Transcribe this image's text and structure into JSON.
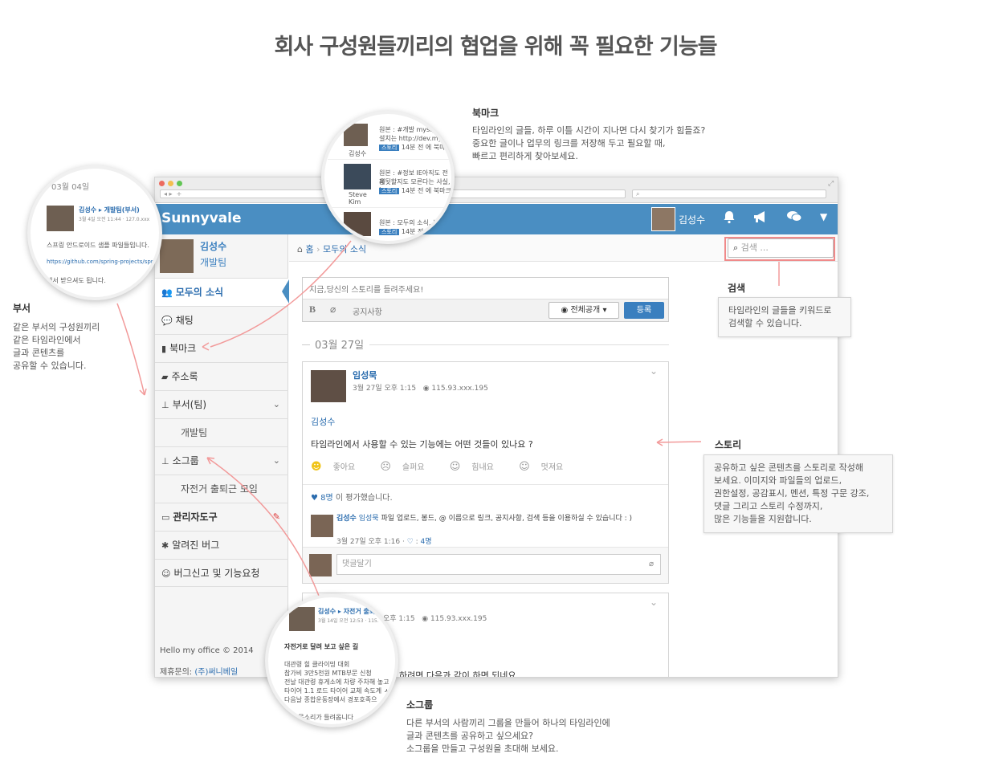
{
  "title": "회사 구성원들끼리의 협업을 위해 꼭 필요한 기능들",
  "colors": {
    "brand": "#4a8ec2",
    "link": "#2a6cae",
    "accent_line": "#f08a8a"
  },
  "app": {
    "logo": "Sunnyvale",
    "user_name": "김성수",
    "user_team": "개발팀",
    "header_icons": [
      "bell-icon",
      "megaphone-icon",
      "chat-icon",
      "caret-down-icon"
    ]
  },
  "sidebar": {
    "items": [
      {
        "label": "모두의 소식",
        "icon": "users-icon"
      },
      {
        "label": "채팅",
        "icon": "chat-icon"
      },
      {
        "label": "북마크",
        "icon": "bookmark-icon"
      },
      {
        "label": "주소록",
        "icon": "book-icon"
      },
      {
        "label": "부서(팀)",
        "icon": "sitemap-icon"
      },
      {
        "label": "개발팀",
        "icon": ""
      },
      {
        "label": "소그룹",
        "icon": "sitemap-icon"
      },
      {
        "label": "자전거 출퇴근 모임",
        "icon": ""
      },
      {
        "label": "관리자도구",
        "icon": "admin-icon"
      },
      {
        "label": "알려진 버그",
        "icon": "bug-icon"
      },
      {
        "label": "버그신고 및 기능요청",
        "icon": "smile-icon"
      }
    ],
    "footer_line1": "Hello my office © 2014",
    "footer_label": "제휴문의:",
    "footer_link": "(주)써니베일"
  },
  "breadcrumb": {
    "home": "홈",
    "current": "모두의 소식"
  },
  "search": {
    "placeholder": "검색 ..."
  },
  "composer": {
    "placeholder": "지금,당신의 스토리를 들려주세요!",
    "notice": "공지사항",
    "visibility": "전체공개",
    "submit": "등록"
  },
  "date_header": "03월 27일",
  "post": {
    "author": "임성묵",
    "meta": "3월 27일 오후 1:15",
    "ip": "115.93.xxx.195",
    "mention": "김성수",
    "body": "타임라인에서 사용할 수 있는 기능에는 어떤 것들이 있나요 ?",
    "reactions": [
      "좋아요",
      "슬퍼요",
      "힘내요",
      "멋져요"
    ],
    "rated_count": "8명",
    "rated_text": "이 평가했습니다.",
    "comment_author": "김성수",
    "comment_mention": "임성묵",
    "comment_text": "파일 업로드, 봉드, @ 이름으로 링크, 공지사항, 검색 등을 이용하실 수 있습니다 : )",
    "comment_meta": "3월 27일 오후 1:16 ·",
    "comment_likes": "4명",
    "comment_placeholder": "댓글달기"
  },
  "post2": {
    "meta": "오후 1:15",
    "ip": "115.93.xxx.195",
    "body": "하려면 다음과 같이 하면 되네요."
  },
  "callouts": {
    "bookmark": {
      "head": "북마크",
      "lines": [
        "타임라인의 글들, 하루 이틀 시간이 지나면 다시 찾기가 힘들죠?",
        "중요한 글이나 업무의 링크를 저장해 두고 필요할 때,",
        "빠르고 편리하게 찾아보세요."
      ]
    },
    "search": {
      "head": "검색",
      "lines": [
        "타임라인의 글들을 키워드로",
        "검색할 수 있습니다."
      ]
    },
    "dept": {
      "head": "부서",
      "lines": [
        "같은 부서의 구성원끼리",
        "같은 타임라인에서",
        "글과 콘텐츠를",
        "공유할 수 있습니다."
      ]
    },
    "story": {
      "head": "스토리",
      "lines": [
        "공유하고 싶은 콘텐츠를 스토리로 작성해",
        "보세요. 이미지와 파일들의 업로드,",
        "권한설정, 공감표시, 멘션, 특정 구문 강조,",
        "댓글 그리고 스토리 수정까지,",
        "많은 기능들을 지원합니다."
      ]
    },
    "group": {
      "head": "소그룹",
      "lines": [
        "다른 부서의 사람끼리 그룹을 만들어 하나의 타임라인에",
        "글과 콘텐츠를 공유하고 싶으세요?",
        "소그룹을 만들고 구성원을 초대해 보세요."
      ]
    }
  },
  "zoom_bookmark": {
    "rows": [
      {
        "name": "김성수",
        "l1": "원본 : #개발 mysql",
        "l2": "설치는 http://dev.mys",
        "tag": "스토리",
        "time": "14분 전 에 북마"
      },
      {
        "name": "Steve Kim",
        "l1": "원본 : #정보 IE아직도 전체",
        "l2": "용됫할지도 모른다는 사실, I",
        "tag": "스토리",
        "time": "14분 전 에 북마크"
      },
      {
        "name": "",
        "l1": "원본 : 모두의 소식, 브",
        "l2": "",
        "tag": "스토리",
        "time": "14분 전"
      }
    ]
  },
  "zoom_dept": {
    "date": "03월 04일",
    "author": "김성수 ▸ 개발팀(부서)",
    "meta": "3월 4일 오전 11:44 · 127.0.xxx",
    "body": "스프링 안드로이드 샘플 파일들입니다.",
    "link": "https://github.com/spring-projects/spr",
    "tail": "에서 받으셔도 됩니다."
  },
  "zoom_group": {
    "author": "김성수 ▸ 자전거 출퇴",
    "meta": "3월 14일 오전 12:53 · 115.",
    "heading": "자전거로 달려 보고 싶은 길",
    "lines": [
      "대관령 힐 클라이밍 대회",
      "참가비 3만5천원 MTB부문 신청",
      "전날 대관령 휴게소에 차량 주차해 놓고",
      "타이어 1.1 로드 타이어 교체 속도계 ㅅ",
      "다음날 종합운동장에서 경포호족으",
      "ㅅ",
      "역인 목소리가 들려옵니다"
    ]
  }
}
